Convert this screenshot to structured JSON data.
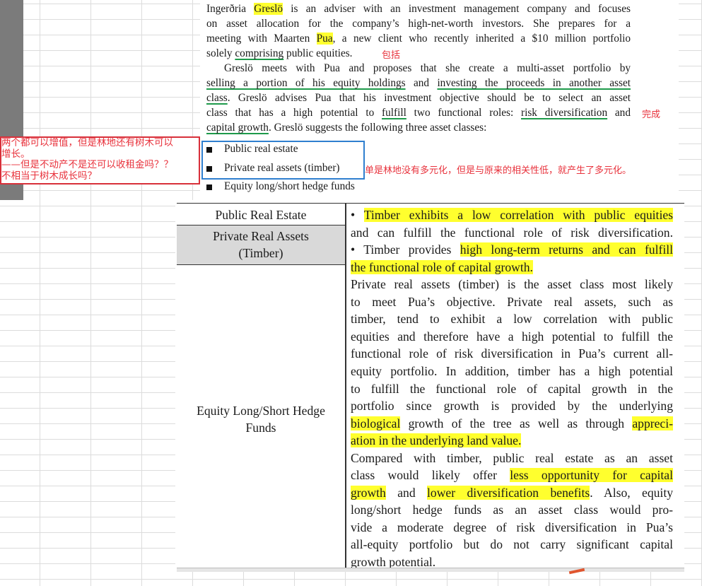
{
  "top_paragraph": [
    {
      "indent": false,
      "j": true,
      "segs": [
        {
          "t": "Ingerðria "
        },
        {
          "t": "Greslö",
          "hl": true
        },
        {
          "t": " is an adviser with an investment management company and focuses"
        }
      ]
    },
    {
      "indent": false,
      "j": true,
      "segs": [
        {
          "t": "on asset allocation for the company’s high-net-worth investors. She prepares for a"
        }
      ]
    },
    {
      "indent": false,
      "j": true,
      "segs": [
        {
          "t": "meeting with Maarten "
        },
        {
          "t": "Pua",
          "hl": true
        },
        {
          "t": ", a new client who recently inherited a $10 million portfolio"
        }
      ]
    },
    {
      "indent": false,
      "j": false,
      "segs": [
        {
          "t": "solely "
        },
        {
          "t": "comprising",
          "ul": true
        },
        {
          "t": " public equities."
        }
      ]
    },
    {
      "indent": true,
      "j": true,
      "segs": [
        {
          "t": "Greslö meets with Pua and proposes that she create a multi-asset portfolio by"
        }
      ]
    },
    {
      "indent": false,
      "j": true,
      "segs": [
        {
          "t": "selling a portion of his equity holdings",
          "ul": true
        },
        {
          "t": " and "
        },
        {
          "t": "investing the proceeds in another asset",
          "ul": true
        }
      ]
    },
    {
      "indent": false,
      "j": true,
      "segs": [
        {
          "t": "class",
          "ul": true
        },
        {
          "t": ". Greslö advises Pua that his investment objective should be to select an asset"
        }
      ]
    },
    {
      "indent": false,
      "j": true,
      "segs": [
        {
          "t": "class that has a high potential to "
        },
        {
          "t": "fulfill",
          "ul": true
        },
        {
          "t": " two functional roles: "
        },
        {
          "t": "risk diversification",
          "ul": true
        },
        {
          "t": " and"
        }
      ]
    },
    {
      "indent": false,
      "j": false,
      "segs": [
        {
          "t": "capital growth",
          "ul": true
        },
        {
          "t": ". Greslö suggests the following three asset classes:"
        }
      ]
    }
  ],
  "bullets": [
    "Public real estate",
    "Private real assets (timber)",
    "Equity long/short hedge funds"
  ],
  "annotations": {
    "comprising_note": "包括",
    "fulfill_note": "完成",
    "timber_note": "单是林地没有多元化，但是与原来的相关性低，就产生了多元化。",
    "left_box": [
      "两个都可以增值，但是林地还有树木可以",
      "增长。",
      "——但是不动产不是还可以收租金吗？？",
      "不相当于树木成长吗？"
    ]
  },
  "table": {
    "left_cells": [
      "Public Real Estate",
      "Private Real Assets",
      "(Timber)",
      "Equity Long/Short Hedge",
      "Funds"
    ],
    "right_lines": [
      {
        "j": true,
        "segs": [
          {
            "t": "• "
          },
          {
            "t": "Timber exhibits a low correlation with public equities",
            "hl": true
          }
        ]
      },
      {
        "j": true,
        "segs": [
          {
            "t": "and can fulfill the functional role of risk diversification."
          }
        ]
      },
      {
        "j": true,
        "segs": [
          {
            "t": "• Timber provides "
          },
          {
            "t": "high long-term returns and can fulfill",
            "hl": true
          }
        ]
      },
      {
        "j": false,
        "segs": [
          {
            "t": "the functional role of capital growth.",
            "hl": true
          }
        ]
      },
      {
        "j": true,
        "segs": [
          {
            "t": "Private real assets (timber) is the asset class most likely"
          }
        ]
      },
      {
        "j": true,
        "segs": [
          {
            "t": "to meet Pua’s objective. Private real assets, such as"
          }
        ]
      },
      {
        "j": true,
        "segs": [
          {
            "t": "timber, tend to exhibit a low correlation with public"
          }
        ]
      },
      {
        "j": true,
        "segs": [
          {
            "t": "equities and therefore have a high potential to fulfill the"
          }
        ]
      },
      {
        "j": true,
        "segs": [
          {
            "t": "functional role of risk diversification in Pua’s current all-"
          }
        ]
      },
      {
        "j": true,
        "segs": [
          {
            "t": "equity portfolio. In addition, timber has a high potential"
          }
        ]
      },
      {
        "j": true,
        "segs": [
          {
            "t": "to fulfill the functional role of capital growth in the"
          }
        ]
      },
      {
        "j": true,
        "segs": [
          {
            "t": "portfolio since growth is provided by the underlying"
          }
        ]
      },
      {
        "j": true,
        "segs": [
          {
            "t": "biological",
            "hl": true
          },
          {
            "t": " growth of the tree as well as through "
          },
          {
            "t": "appreci-",
            "hl": true
          }
        ]
      },
      {
        "j": false,
        "segs": [
          {
            "t": "ation in the underlying land value.",
            "hl": true
          }
        ]
      },
      {
        "j": true,
        "segs": [
          {
            "t": "Compared with timber, public real estate as an asset"
          }
        ]
      },
      {
        "j": true,
        "segs": [
          {
            "t": "class would likely offer "
          },
          {
            "t": "less opportunity for capital",
            "hl": true
          }
        ]
      },
      {
        "j": true,
        "segs": [
          {
            "t": "growth",
            "hl": true
          },
          {
            "t": " and "
          },
          {
            "t": "lower diversification benefits",
            "hl": true
          },
          {
            "t": ". Also, equity"
          }
        ]
      },
      {
        "j": true,
        "segs": [
          {
            "t": "long/short hedge funds as an asset class would pro-"
          }
        ]
      },
      {
        "j": true,
        "segs": [
          {
            "t": "vide a moderate degree of risk diversification in Pua’s"
          }
        ]
      },
      {
        "j": true,
        "segs": [
          {
            "t": "all-equity portfolio but do not carry significant capital"
          }
        ]
      },
      {
        "j": false,
        "segs": [
          {
            "t": "growth potential."
          }
        ]
      }
    ]
  }
}
